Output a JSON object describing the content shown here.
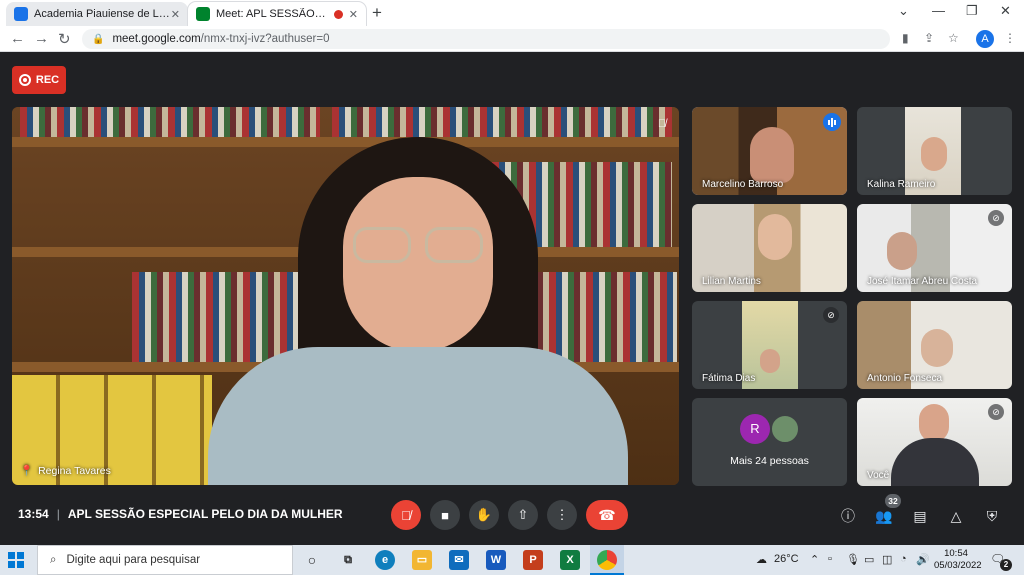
{
  "browser": {
    "tabs": [
      {
        "title": "Academia Piauiense de Letras: ag",
        "favicon_color": "#1a73e8"
      },
      {
        "title": "Meet: APL SESSÃO ESPECIAL",
        "favicon_color": "#00832d"
      }
    ],
    "new_tab": "+",
    "url_host": "meet.google.com",
    "url_path": "/nmx-tnxj-ivz?authuser=0",
    "profile_initial": "A"
  },
  "meet": {
    "rec_label": "REC",
    "main_tile": {
      "name": "Regina Tavares"
    },
    "tiles": [
      {
        "name": "Marcelino Barroso",
        "speaking": true
      },
      {
        "name": "Kalina Rameiro"
      },
      {
        "name": "Lilian Martins"
      },
      {
        "name": "José Itamar Abreu Costa",
        "muted": true
      },
      {
        "name": "Fátima Dias",
        "muted": true
      },
      {
        "name": "Antonio Fonseca"
      },
      {
        "name": "Você",
        "muted": true
      }
    ],
    "more": {
      "avatar_initial": "R",
      "avatar_color": "#9c27b0",
      "label": "Mais 24 pessoas"
    },
    "time": "13:54",
    "meeting_title": "APL SESSÃO ESPECIAL PELO DIA DA MULHER",
    "participant_count": "32",
    "colors": {
      "accent": "#8ab4f8",
      "danger": "#ea4335",
      "bar": "#202124"
    }
  },
  "taskbar": {
    "search_placeholder": "Digite aqui para pesquisar",
    "weather": "26°C",
    "clock_time": "10:54",
    "clock_date": "05/03/2022",
    "notifications": "2",
    "apps": [
      "task-view",
      "edge",
      "file-explorer",
      "mail",
      "word",
      "powerpoint",
      "excel",
      "chrome"
    ]
  }
}
